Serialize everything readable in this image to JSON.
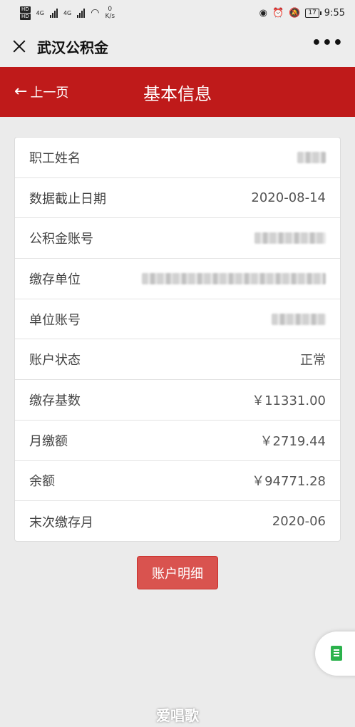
{
  "status_bar": {
    "net_badges": [
      "HD",
      "HD"
    ],
    "net_type_1": "4G",
    "net_type_2": "4G",
    "speed_value": "0",
    "speed_unit": "K/s",
    "battery": "17",
    "time": "9:55"
  },
  "title_bar": {
    "app_title": "武汉公积金",
    "more_label": "•••"
  },
  "header": {
    "back_label": "上一页",
    "page_title": "基本信息",
    "color": "#bf1a1a"
  },
  "info": {
    "rows": [
      {
        "label": "职工姓名",
        "value": "",
        "redacted": true
      },
      {
        "label": "数据截止日期",
        "value": "2020-08-14"
      },
      {
        "label": "公积金账号",
        "value": "",
        "redacted": true
      },
      {
        "label": "缴存单位",
        "value": "",
        "redacted": true
      },
      {
        "label": "单位账号",
        "value": "",
        "redacted": true
      },
      {
        "label": "账户状态",
        "value": "正常"
      },
      {
        "label": "缴存基数",
        "value": "￥11331.00"
      },
      {
        "label": "月缴额",
        "value": "￥2719.44"
      },
      {
        "label": "余额",
        "value": "￥94771.28"
      },
      {
        "label": "末次缴存月",
        "value": "2020-06"
      }
    ]
  },
  "actions": {
    "detail_label": "账户明细",
    "button_color": "#d9534f"
  },
  "watermark": "爱唱歌"
}
